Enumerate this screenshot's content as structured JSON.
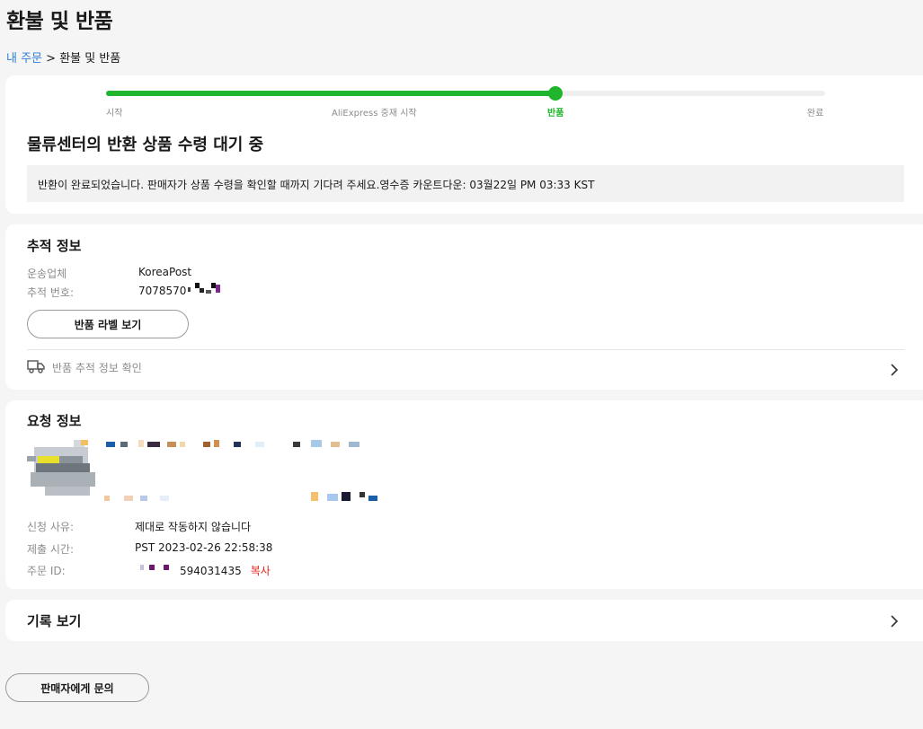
{
  "page": {
    "title": "환불 및 반품",
    "breadcrumb": {
      "parent": "내 주문",
      "separator": ">",
      "current": "환불 및 반품"
    }
  },
  "progress": {
    "steps": [
      "시작",
      "AliExpress 중재 시작",
      "반품",
      "완료"
    ],
    "active_step": 2,
    "fill_fraction": 0.625,
    "status_title": "물류센터의 반환 상품 수령 대기 중",
    "notice": "반환이 완료되었습니다. 판매자가 상품 수령을 확인할 때까지 기다려 주세요.영수증 카운트다운: 03월22일 PM 03:33 KST"
  },
  "tracking": {
    "title": "추적 정보",
    "carrier_label": "운송업체",
    "carrier_value": "KoreaPost",
    "number_label": "추적 번호:",
    "number_value": "7078570",
    "label_button": "반품 라벨 보기",
    "check_row": "반품 추적 정보 확인"
  },
  "request": {
    "title": "요청 정보",
    "reason_label": "신청 사유:",
    "reason_value": "제대로 작동하지 않습니다",
    "time_label": "제출 시간:",
    "time_value": "PST 2023-02-26 22:58:38",
    "order_label": "주문 ID:",
    "order_value": "594031435",
    "copy_label": "복사"
  },
  "history": {
    "title": "기록 보기"
  },
  "footer": {
    "contact_button": "판매자에게 문의"
  },
  "colors": {
    "accent_green": "#1fb52c",
    "link_blue": "#2f7fd6",
    "copy_red": "#e2231a"
  },
  "icons": [
    "truck-icon",
    "chevron-right-icon"
  ]
}
